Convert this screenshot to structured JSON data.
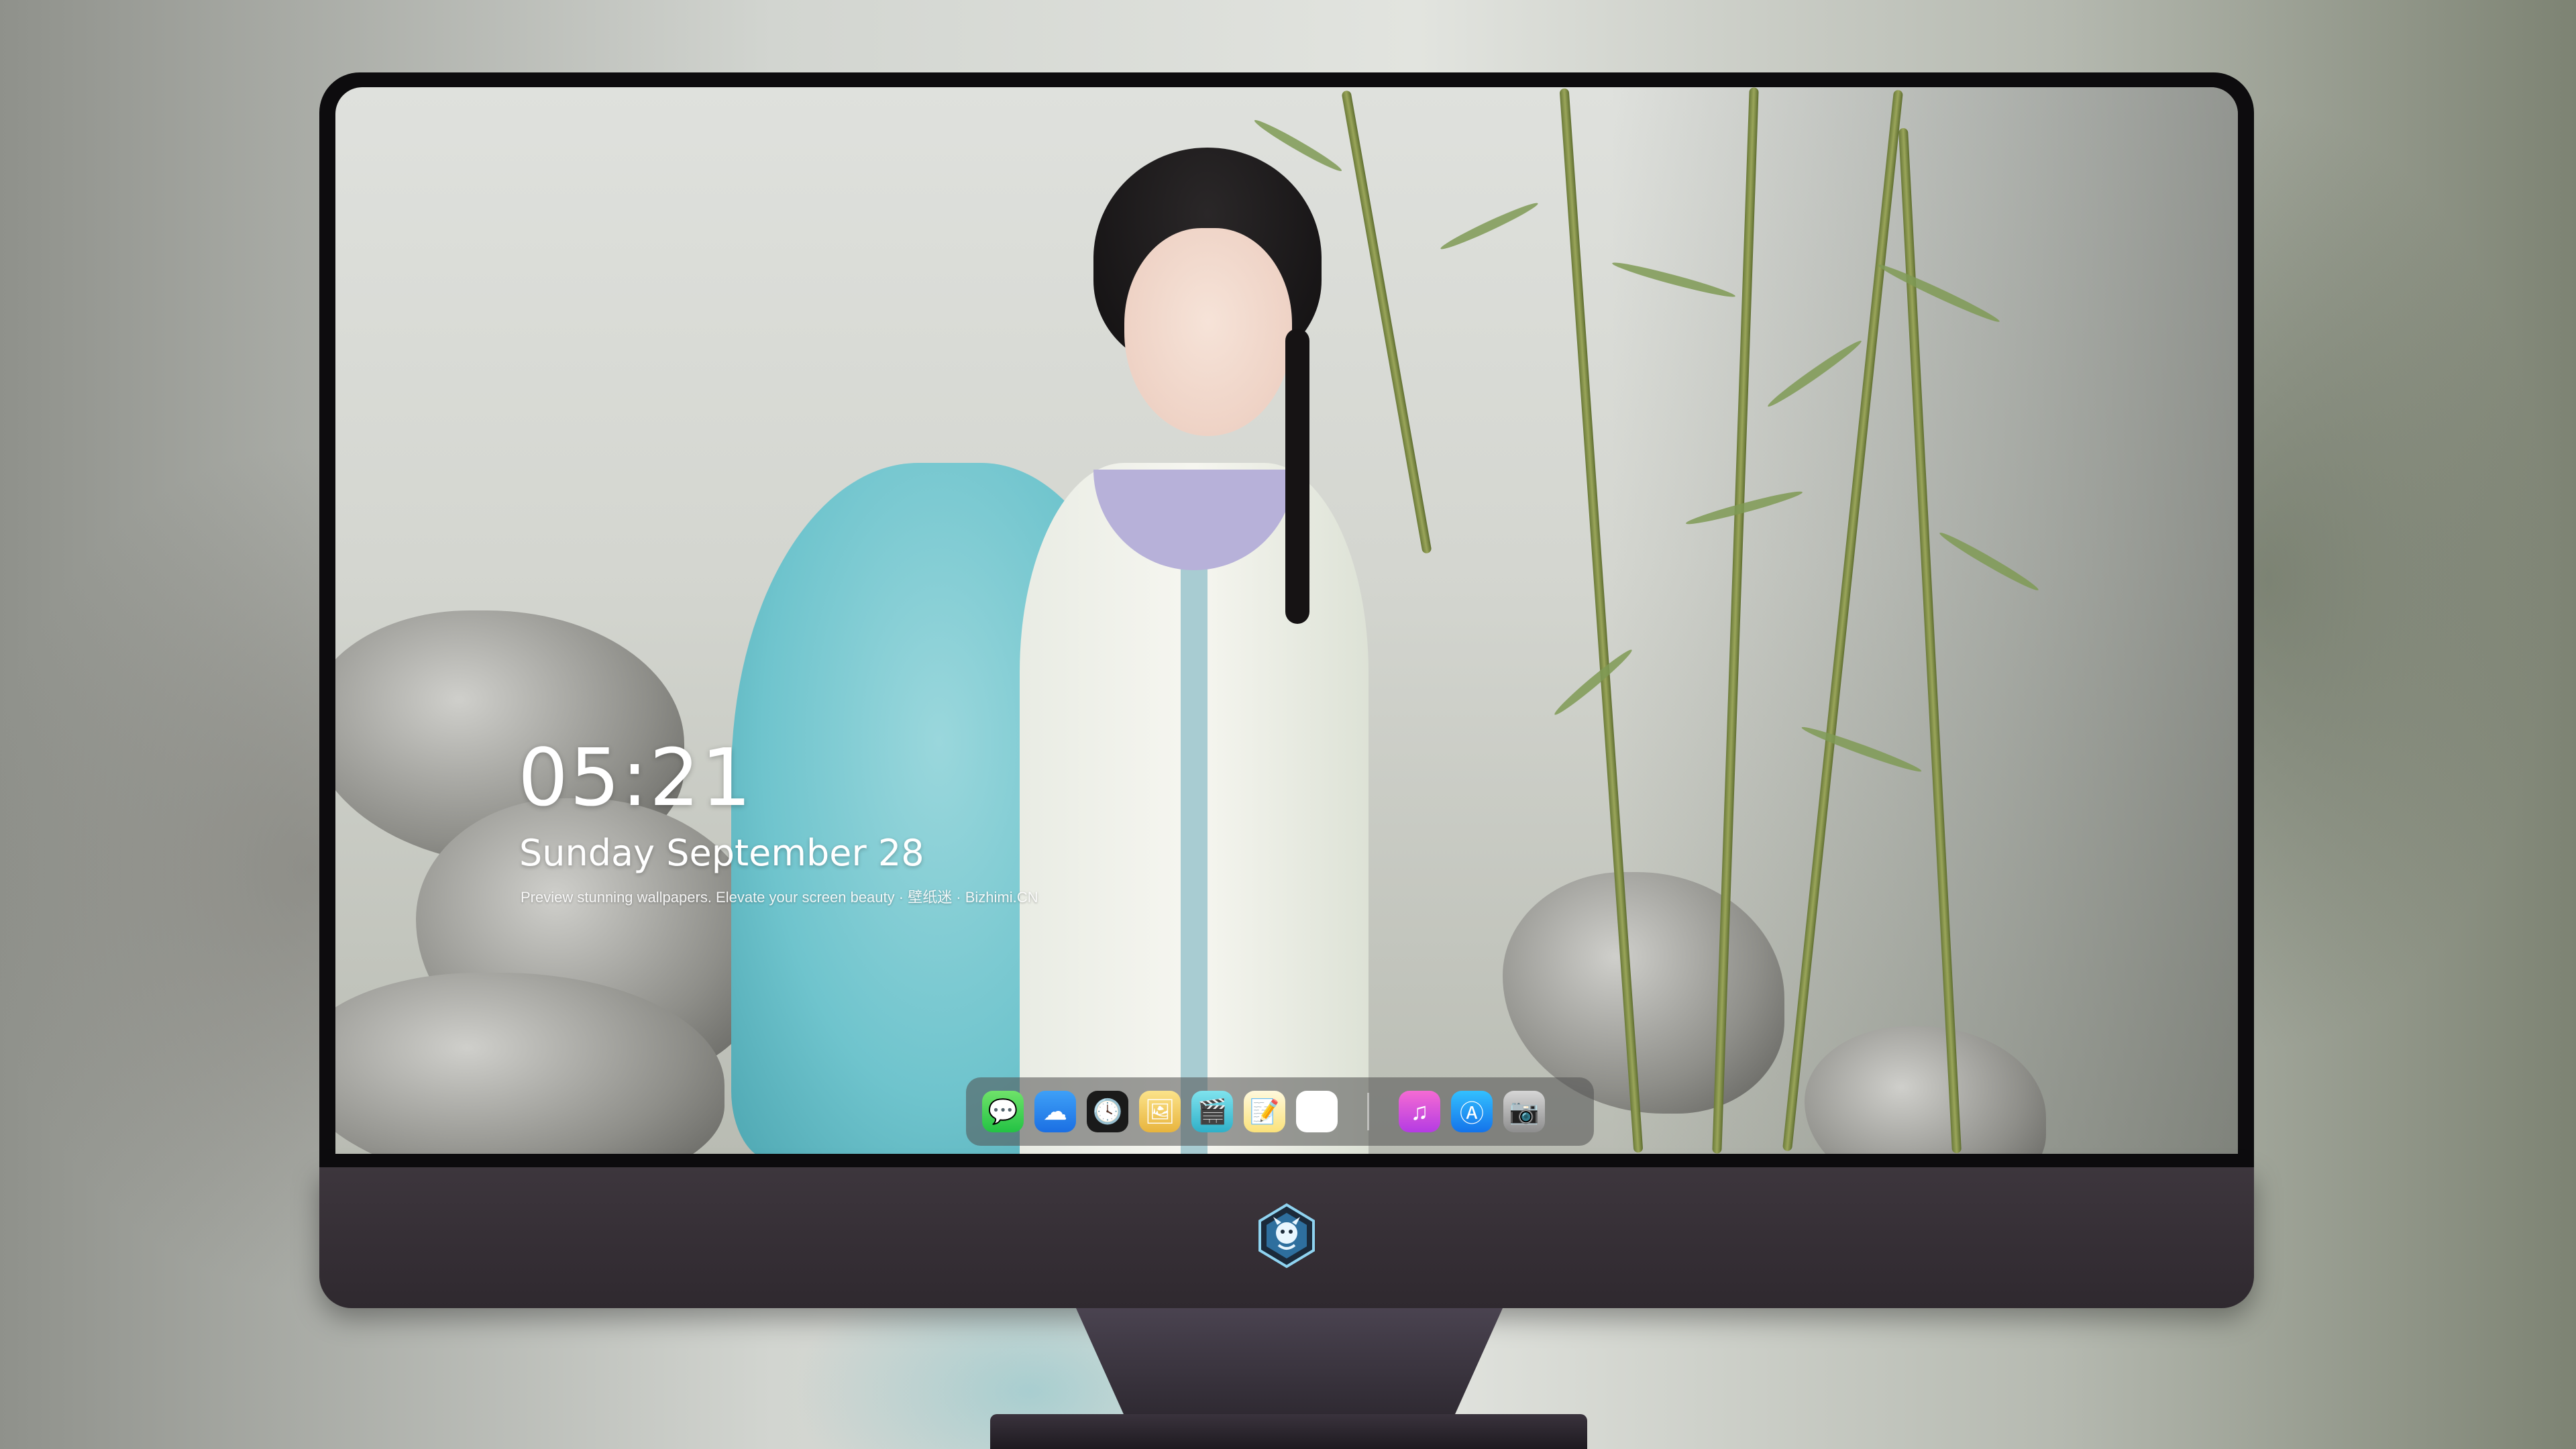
{
  "lock_screen": {
    "time": "05:21",
    "date": "Sunday September  28",
    "tagline": "Preview stunning wallpapers. Elevate your screen beauty · 壁纸迷 · Bizhimi.CN"
  },
  "dock": {
    "apps": [
      {
        "name": "messages-icon",
        "glyph": "💬",
        "color": "#2ac94b"
      },
      {
        "name": "weather-icon",
        "glyph": "☁",
        "color": "#2a86ee"
      },
      {
        "name": "clock-icon",
        "glyph": "🕓",
        "color": "#1a1a1a"
      },
      {
        "name": "preview-icon",
        "glyph": "🖼",
        "color": "#f0c24c"
      },
      {
        "name": "clips-icon",
        "glyph": "🎬",
        "color": "#3fbcd2"
      },
      {
        "name": "notes-icon",
        "glyph": "📝",
        "color": "#fbe27a"
      },
      {
        "name": "photo-booth-icon",
        "glyph": "🏞",
        "color": "#ffffff"
      },
      {
        "name": "music-icon",
        "glyph": "♫",
        "color": "#d552dd"
      },
      {
        "name": "app-store-icon",
        "glyph": "Ⓐ",
        "color": "#1f8cf3"
      },
      {
        "name": "camera-icon",
        "glyph": "📷",
        "color": "#a9a9a9"
      }
    ]
  },
  "chin": {
    "logo_icon": "dragon-badge-icon"
  }
}
